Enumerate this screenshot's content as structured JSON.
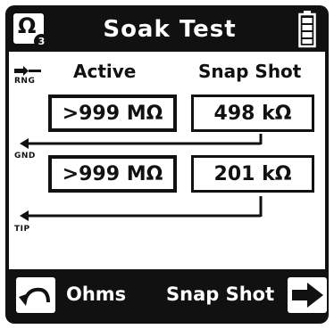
{
  "header": {
    "mode_icon_symbol": "Ω",
    "mode_icon_subscript": "3",
    "title": "Soak Test",
    "battery_icon": "battery-full-icon"
  },
  "columns": {
    "active": "Active",
    "snapshot": "Snap Shot"
  },
  "lines": {
    "ring": "RNG",
    "ground": "GND",
    "tip": "TIP"
  },
  "readings": {
    "ring_to_ground": {
      "active": ">999 MΩ",
      "snapshot": "498 kΩ"
    },
    "ground_to_tip": {
      "active": ">999 MΩ",
      "snapshot": "201 kΩ"
    }
  },
  "softkeys": {
    "left": {
      "label": "Ohms",
      "icon": "back-arrow-icon"
    },
    "right": {
      "label": "Snap Shot",
      "icon": "right-arrow-icon"
    }
  },
  "colors": {
    "bezel": "#111111",
    "screen": "#ffffff"
  }
}
